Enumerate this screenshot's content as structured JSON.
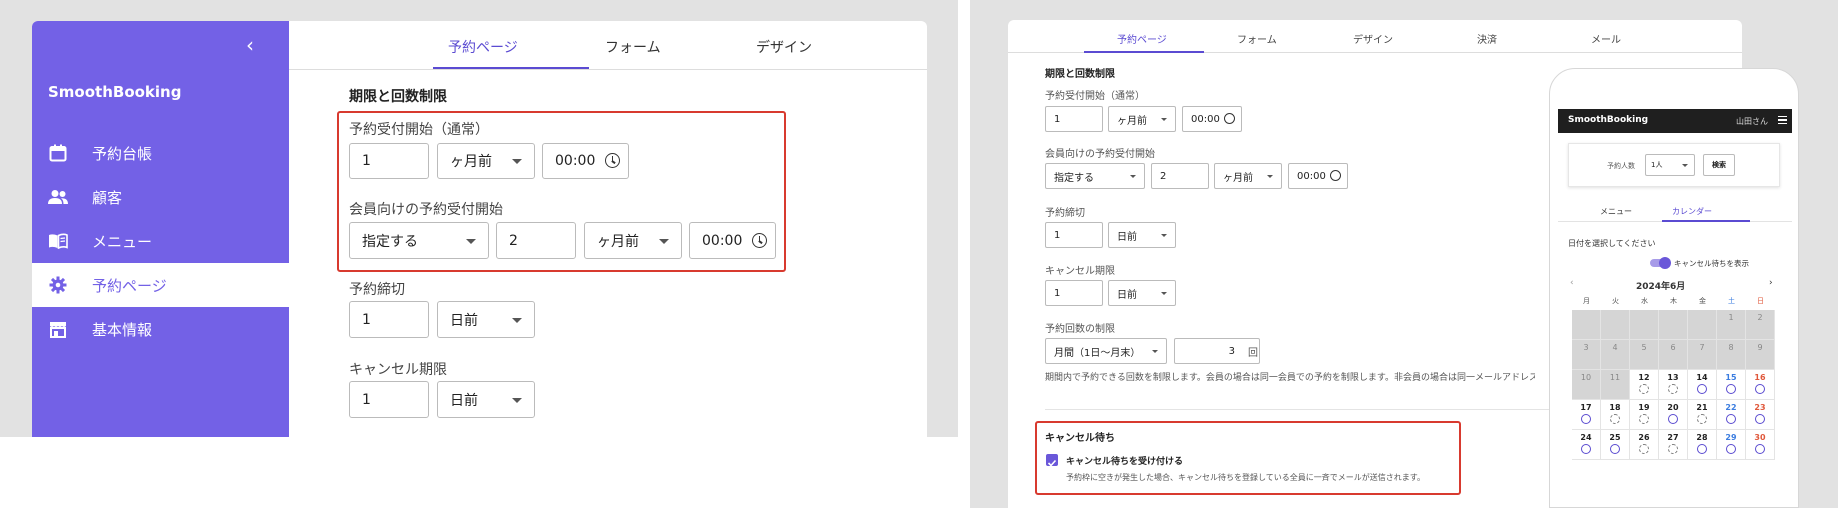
{
  "left": {
    "collapse_icon": "chevron-left-icon",
    "brand": "SmoothBooking",
    "nav": [
      {
        "label": "予約台帳",
        "icon": "calendar-icon"
      },
      {
        "label": "顧客",
        "icon": "users-icon"
      },
      {
        "label": "メニュー",
        "icon": "book-icon"
      },
      {
        "label": "予約ページ",
        "icon": "gear-icon",
        "active": true
      },
      {
        "label": "基本情報",
        "icon": "store-icon"
      }
    ],
    "tabs": [
      "予約ページ",
      "フォーム",
      "デザイン"
    ],
    "section_title": "期限と回数制限",
    "start": {
      "label": "予約受付開始（通常）",
      "value": "1",
      "unit": "ヶ月前",
      "time": "00:00"
    },
    "member_start": {
      "label": "会員向けの予約受付開始",
      "mode": "指定する",
      "value": "2",
      "unit": "ヶ月前",
      "time": "00:00"
    },
    "deadline": {
      "label": "予約締切",
      "value": "1",
      "unit": "日前"
    },
    "cancel": {
      "label": "キャンセル期限",
      "value": "1",
      "unit": "日前"
    },
    "accent": "#7361e6",
    "highlight": "#d83a2f"
  },
  "right": {
    "tabs": [
      "予約ページ",
      "フォーム",
      "デザイン",
      "決済",
      "メール"
    ],
    "section_title": "期限と回数制限",
    "start": {
      "label": "予約受付開始（通常）",
      "value": "1",
      "unit": "ヶ月前",
      "time": "00:00"
    },
    "member_start": {
      "label": "会員向けの予約受付開始",
      "mode": "指定する",
      "value": "2",
      "unit": "ヶ月前",
      "time": "00:00"
    },
    "deadline": {
      "label": "予約締切",
      "value": "1",
      "unit": "日前"
    },
    "cancel": {
      "label": "キャンセル期限",
      "value": "1",
      "unit": "日前"
    },
    "limit": {
      "label": "予約回数の制限",
      "period": "月間（1日〜月末）",
      "count": "3",
      "suffix": "回",
      "note": "期間内で予約できる回数を制限します。会員の場合は同一会員での予約を制限します。非会員の場合は同一メールアドレスでの予約"
    },
    "waitlist": {
      "title": "キャンセル待ち",
      "checkbox_label": "キャンセル待ちを受け付ける",
      "checked": true,
      "note": "予約枠に空きが発生した場合、キャンセル待ちを登録している全員に一斉でメールが送信されます。"
    }
  },
  "phone": {
    "brand": "SmoothBooking",
    "user": "山田さん",
    "party_label": "予約人数",
    "party_value": "1人",
    "search_button": "検索",
    "tabs": [
      "メニュー",
      "カレンダー"
    ],
    "prompt": "日付を選択してください",
    "toggle_label": "キャンセル待ちを表示",
    "month": "2024年6月",
    "weekdays": [
      "月",
      "火",
      "水",
      "木",
      "金",
      "土",
      "日"
    ],
    "weeks": [
      [
        {
          "d": "",
          "p": true
        },
        {
          "d": "",
          "p": true
        },
        {
          "d": "",
          "p": true
        },
        {
          "d": "",
          "p": true
        },
        {
          "d": "",
          "p": true
        },
        {
          "d": "1",
          "p": true
        },
        {
          "d": "2",
          "p": true
        }
      ],
      [
        {
          "d": "3",
          "p": true
        },
        {
          "d": "4",
          "p": true
        },
        {
          "d": "5",
          "p": true
        },
        {
          "d": "6",
          "p": true
        },
        {
          "d": "7",
          "p": true
        },
        {
          "d": "8",
          "p": true
        },
        {
          "d": "9",
          "p": true
        }
      ],
      [
        {
          "d": "10",
          "p": true
        },
        {
          "d": "11",
          "p": true
        },
        {
          "d": "12",
          "s": "dashed"
        },
        {
          "d": "13",
          "s": "dashed"
        },
        {
          "d": "14",
          "s": "open"
        },
        {
          "d": "15",
          "s": "open"
        },
        {
          "d": "16",
          "s": "open"
        }
      ],
      [
        {
          "d": "17",
          "s": "open"
        },
        {
          "d": "18",
          "s": "dashed"
        },
        {
          "d": "19",
          "s": "dashed"
        },
        {
          "d": "20",
          "s": "open"
        },
        {
          "d": "21",
          "s": "dashed"
        },
        {
          "d": "22",
          "s": "open"
        },
        {
          "d": "23",
          "s": "open"
        }
      ],
      [
        {
          "d": "24",
          "s": "open"
        },
        {
          "d": "25",
          "s": "open"
        },
        {
          "d": "26",
          "s": "dashed"
        },
        {
          "d": "27",
          "s": "dashed"
        },
        {
          "d": "28",
          "s": "open"
        },
        {
          "d": "29",
          "s": "open"
        },
        {
          "d": "30",
          "s": "open"
        }
      ]
    ]
  }
}
